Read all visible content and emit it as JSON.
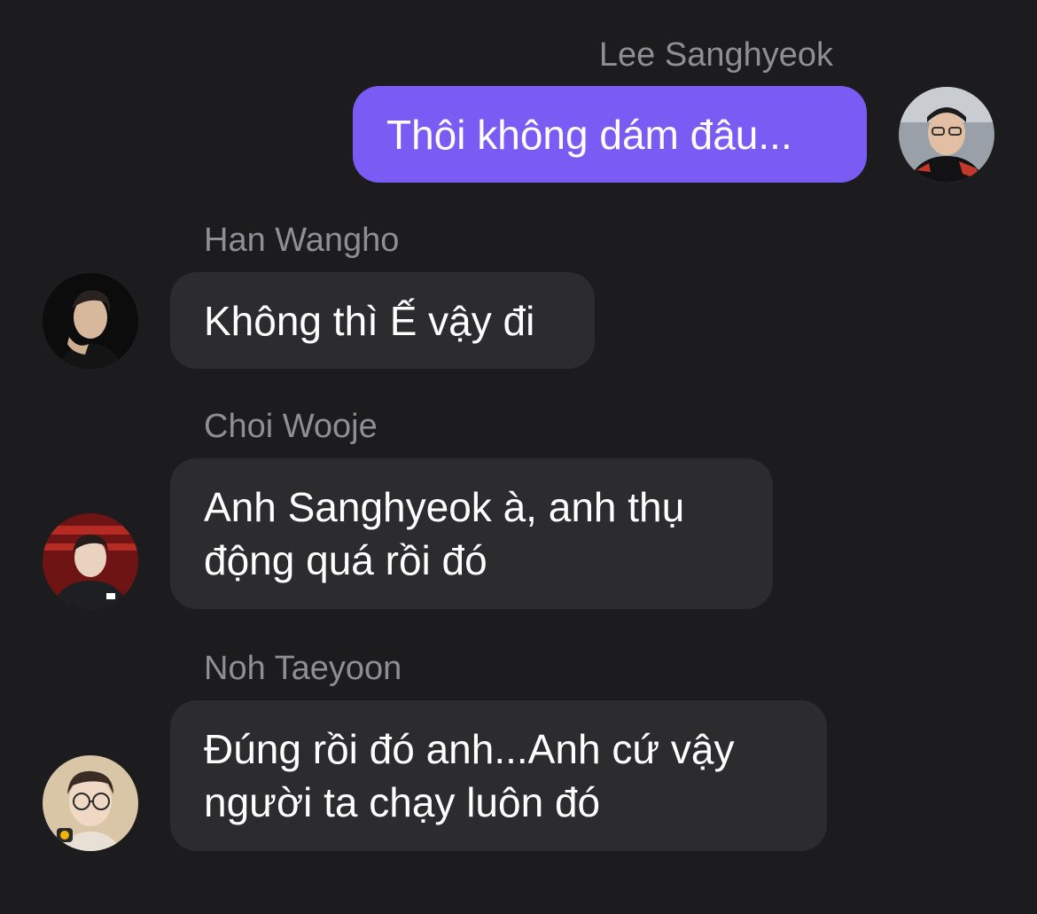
{
  "messages": [
    {
      "sender": "Lee Sanghyeok",
      "text": "Thôi không dám đâu...",
      "outgoing": true
    },
    {
      "sender": "Han Wangho",
      "text": "Không thì Ế vậy đi",
      "outgoing": false
    },
    {
      "sender": "Choi Wooje",
      "text": "Anh Sanghyeok à, anh thụ động quá rồi đó",
      "outgoing": false
    },
    {
      "sender": "Noh Taeyoon",
      "text": "Đúng rồi đó anh...Anh cứ vậy người ta chạy luôn đó",
      "outgoing": false
    }
  ],
  "colors": {
    "background": "#1c1c1e",
    "outgoing_bubble": "#7a5cf5",
    "incoming_bubble": "#2c2c2e",
    "sender_name": "#8e8e93",
    "message_text": "#ffffff"
  }
}
